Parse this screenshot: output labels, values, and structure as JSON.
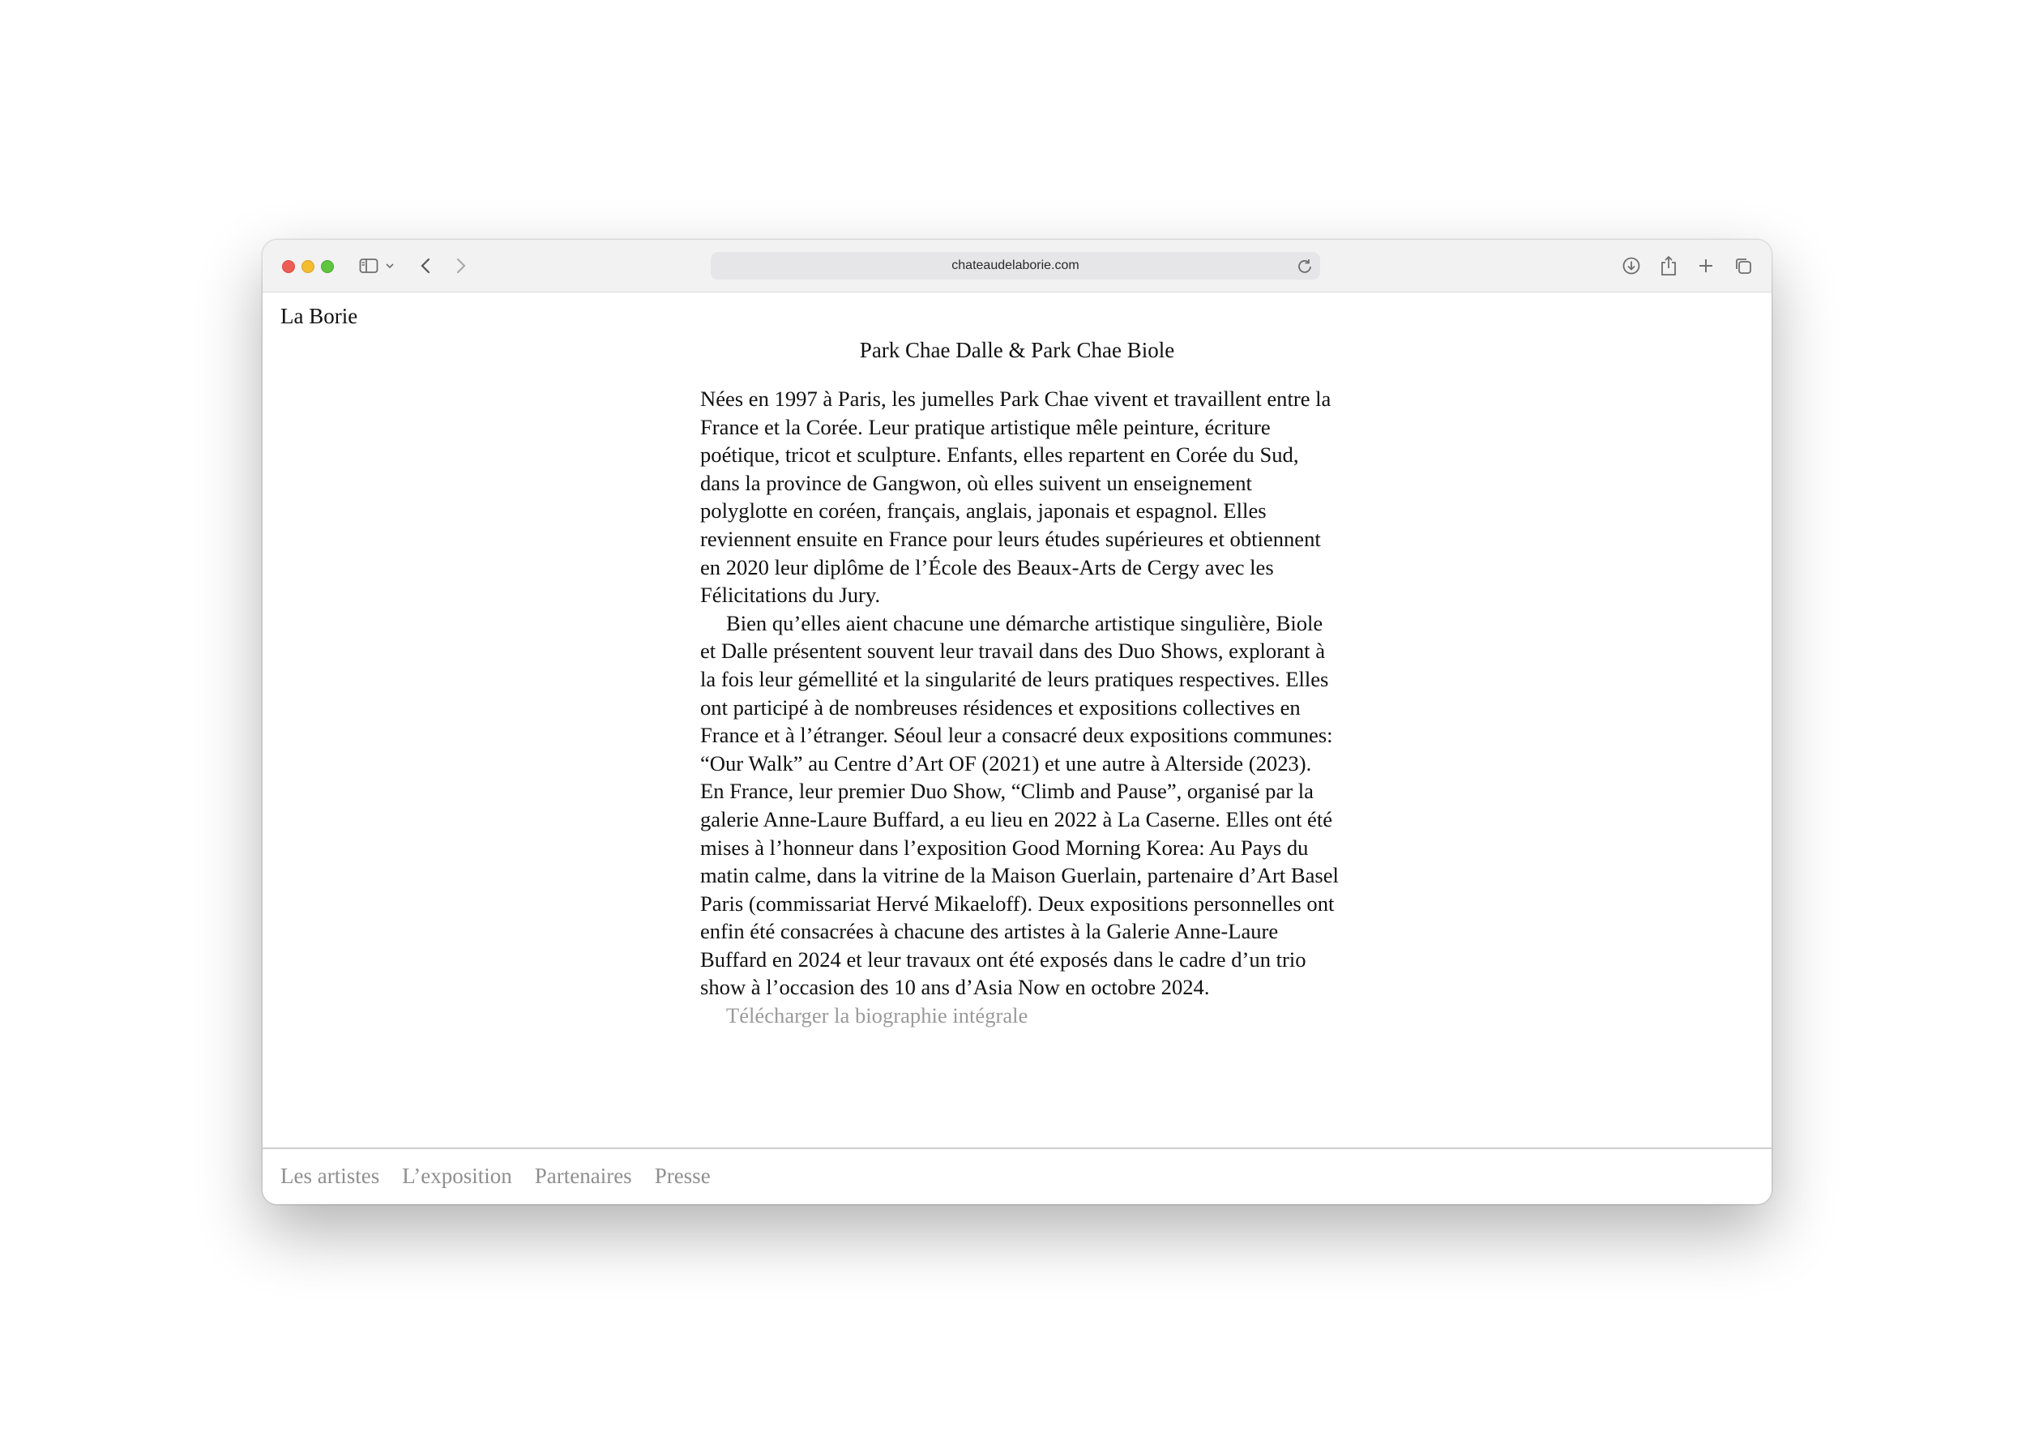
{
  "browser": {
    "url": "chateaudelaborie.com"
  },
  "site": {
    "title": "La Borie"
  },
  "artist": {
    "heading": "Park Chae Dalle & Park Chae Biole",
    "paragraph1": "Nées en 1997 à Paris, les jumelles Park Chae vivent et travaillent entre la France et la Corée. Leur pratique artistique mêle peinture, écriture poétique, tricot et sculpture. Enfants, elles repartent en Corée du Sud, dans la province de Gangwon, où elles suivent un enseignement polyglotte en coréen, français, anglais, japonais et espagnol. Elles reviennent ensuite en France pour leurs études supérieures et obtiennent en 2020 leur diplôme de l’École des Beaux-Arts de Cergy avec les Félicitations du Jury.",
    "paragraph2": "Bien qu’elles aient chacune une démarche artistique singulière, Biole et Dalle présentent souvent leur travail dans des Duo Shows, explorant à la fois leur gémellité et la singularité de leurs pratiques respectives. Elles ont participé à de nombreuses résidences et expositions collectives en France et à l’étranger. Séoul leur a consacré deux expositions communes: “Our Walk” au Centre d’Art OF (2021) et une autre à Alterside (2023). En France, leur premier Duo Show, “Climb and Pause”, organisé par la galerie Anne-Laure Buffard, a eu lieu en 2022 à La Caserne. Elles ont été mises à l’honneur dans l’exposition Good Morning Korea: Au Pays du matin calme, dans la vitrine de la Maison Guerlain, partenaire d’Art Basel Paris (commissariat Hervé Mikaeloff). Deux expositions personnelles ont enfin été consacrées à chacune des artistes à la Galerie Anne-Laure Buffard en 2024 et leur travaux ont été exposés dans le cadre d’un trio show à l’occasion des 10 ans d’Asia Now en octobre 2024.",
    "download_label": "Télécharger la biographie intégrale"
  },
  "footer": {
    "nav": [
      "Les artistes",
      "L’exposition",
      "Partenaires",
      "Presse"
    ]
  }
}
